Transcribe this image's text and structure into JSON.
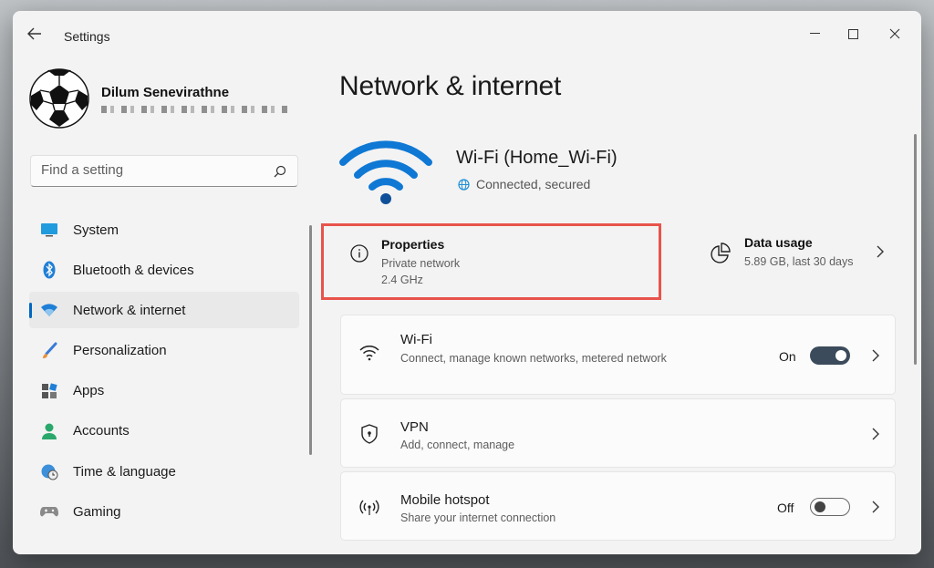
{
  "window": {
    "title": "Settings"
  },
  "profile": {
    "name": "Dilum Senevirathne"
  },
  "search": {
    "placeholder": "Find a setting"
  },
  "sidebar": {
    "items": [
      {
        "label": "System",
        "icon": "system-icon"
      },
      {
        "label": "Bluetooth & devices",
        "icon": "bluetooth-icon"
      },
      {
        "label": "Network & internet",
        "icon": "network-icon",
        "active": true
      },
      {
        "label": "Personalization",
        "icon": "brush-icon"
      },
      {
        "label": "Apps",
        "icon": "apps-icon"
      },
      {
        "label": "Accounts",
        "icon": "person-icon"
      },
      {
        "label": "Time & language",
        "icon": "globe-clock-icon"
      },
      {
        "label": "Gaming",
        "icon": "gamepad-icon"
      }
    ]
  },
  "main": {
    "title": "Network & internet",
    "network": {
      "name": "Wi-Fi (Home_Wi-Fi)",
      "status": "Connected, secured"
    },
    "properties": {
      "title": "Properties",
      "line1": "Private network",
      "line2": "2.4 GHz"
    },
    "data_usage": {
      "title": "Data usage",
      "detail": "5.89 GB, last 30 days"
    },
    "cards": [
      {
        "title": "Wi-Fi",
        "description": "Connect, manage known networks, metered network",
        "toggle_label": "On",
        "toggle_state": true
      },
      {
        "title": "VPN",
        "description": "Add, connect, manage"
      },
      {
        "title": "Mobile hotspot",
        "description": "Share your internet connection",
        "toggle_label": "Off",
        "toggle_state": false
      }
    ]
  },
  "colors": {
    "accent": "#0067c0",
    "highlight_border": "#e8534b",
    "wifi_blue": "#0f78d4"
  }
}
